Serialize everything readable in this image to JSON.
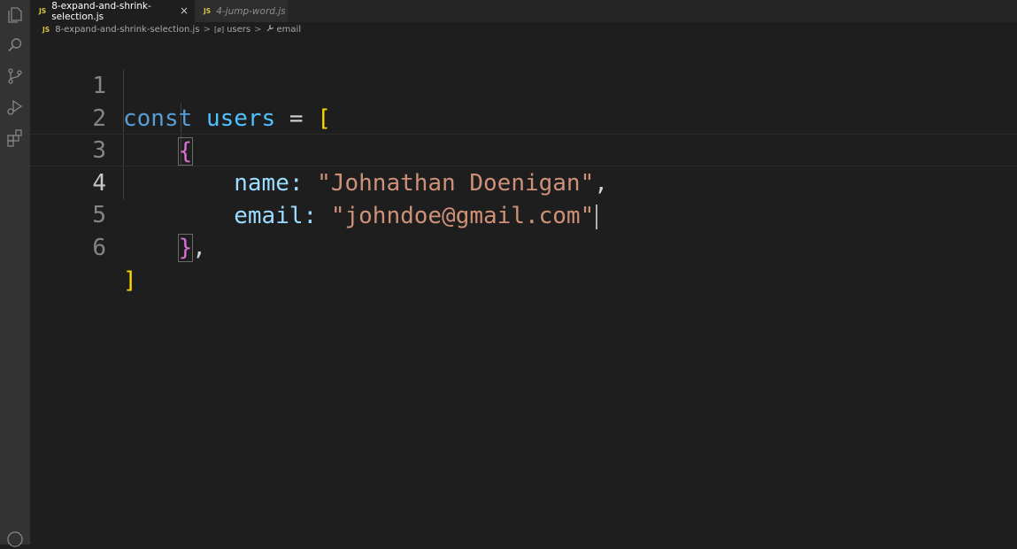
{
  "activity_bar": {
    "icons": [
      "explorer-icon",
      "search-icon",
      "source-control-icon",
      "run-debug-icon",
      "extensions-icon",
      "account-icon"
    ]
  },
  "tabs": [
    {
      "badge": "JS",
      "label": "8-expand-and-shrink-selection.js",
      "close": "×"
    },
    {
      "badge": "JS",
      "label": "4-jump-word.js"
    }
  ],
  "breadcrumb": {
    "file_badge": "JS",
    "file": "8-expand-and-shrink-selection.js",
    "symbol1_icon": "[ø]",
    "symbol1": "users",
    "symbol2": "email",
    "sep": ">"
  },
  "code": {
    "line_numbers": [
      "1",
      "2",
      "3",
      "4",
      "5",
      "6"
    ],
    "l1": {
      "kw": "const",
      "var": "users",
      "eq": "=",
      "open": "["
    },
    "l2": {
      "open": "{"
    },
    "l3": {
      "key": "name",
      "colon": ":",
      "value": "\"Johnathan Doenigan\"",
      "comma": ","
    },
    "l4": {
      "key": "email",
      "colon": ":",
      "value": "\"johndoe@gmail.com\""
    },
    "l5": {
      "close": "}",
      "comma": ","
    },
    "l6": {
      "close": "]"
    }
  },
  "colors": {
    "keyword": "#569cd6",
    "variable": "#4fc1ff",
    "property": "#9cdcfe",
    "string": "#ce9178",
    "bracket_level1": "#ffd700",
    "bracket_level2": "#da70d6"
  }
}
